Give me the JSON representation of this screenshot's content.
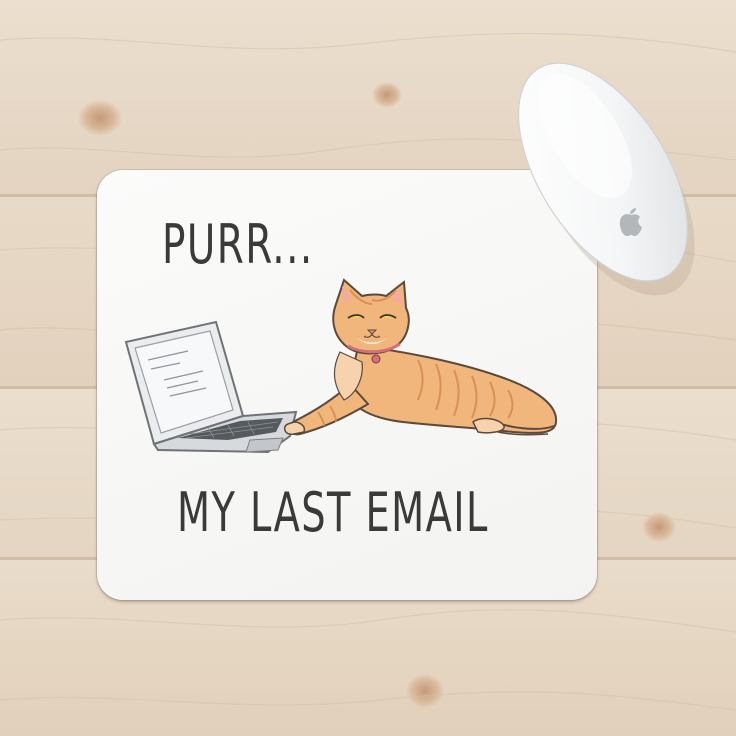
{
  "mousepad": {
    "text_top": "PURR...",
    "text_bottom": "MY LAST EMAIL"
  },
  "icons": {
    "mouse": "magic-mouse-icon",
    "brand": "apple-logo-icon",
    "cat": "orange-tabby-cat-illustration",
    "laptop": "laptop-illustration"
  },
  "colors": {
    "wood": "#e6d8c6",
    "pad": "#f6f6f4",
    "ink": "#3b3a39",
    "cat_fur": "#f1b67c",
    "collar": "#d5707a"
  }
}
